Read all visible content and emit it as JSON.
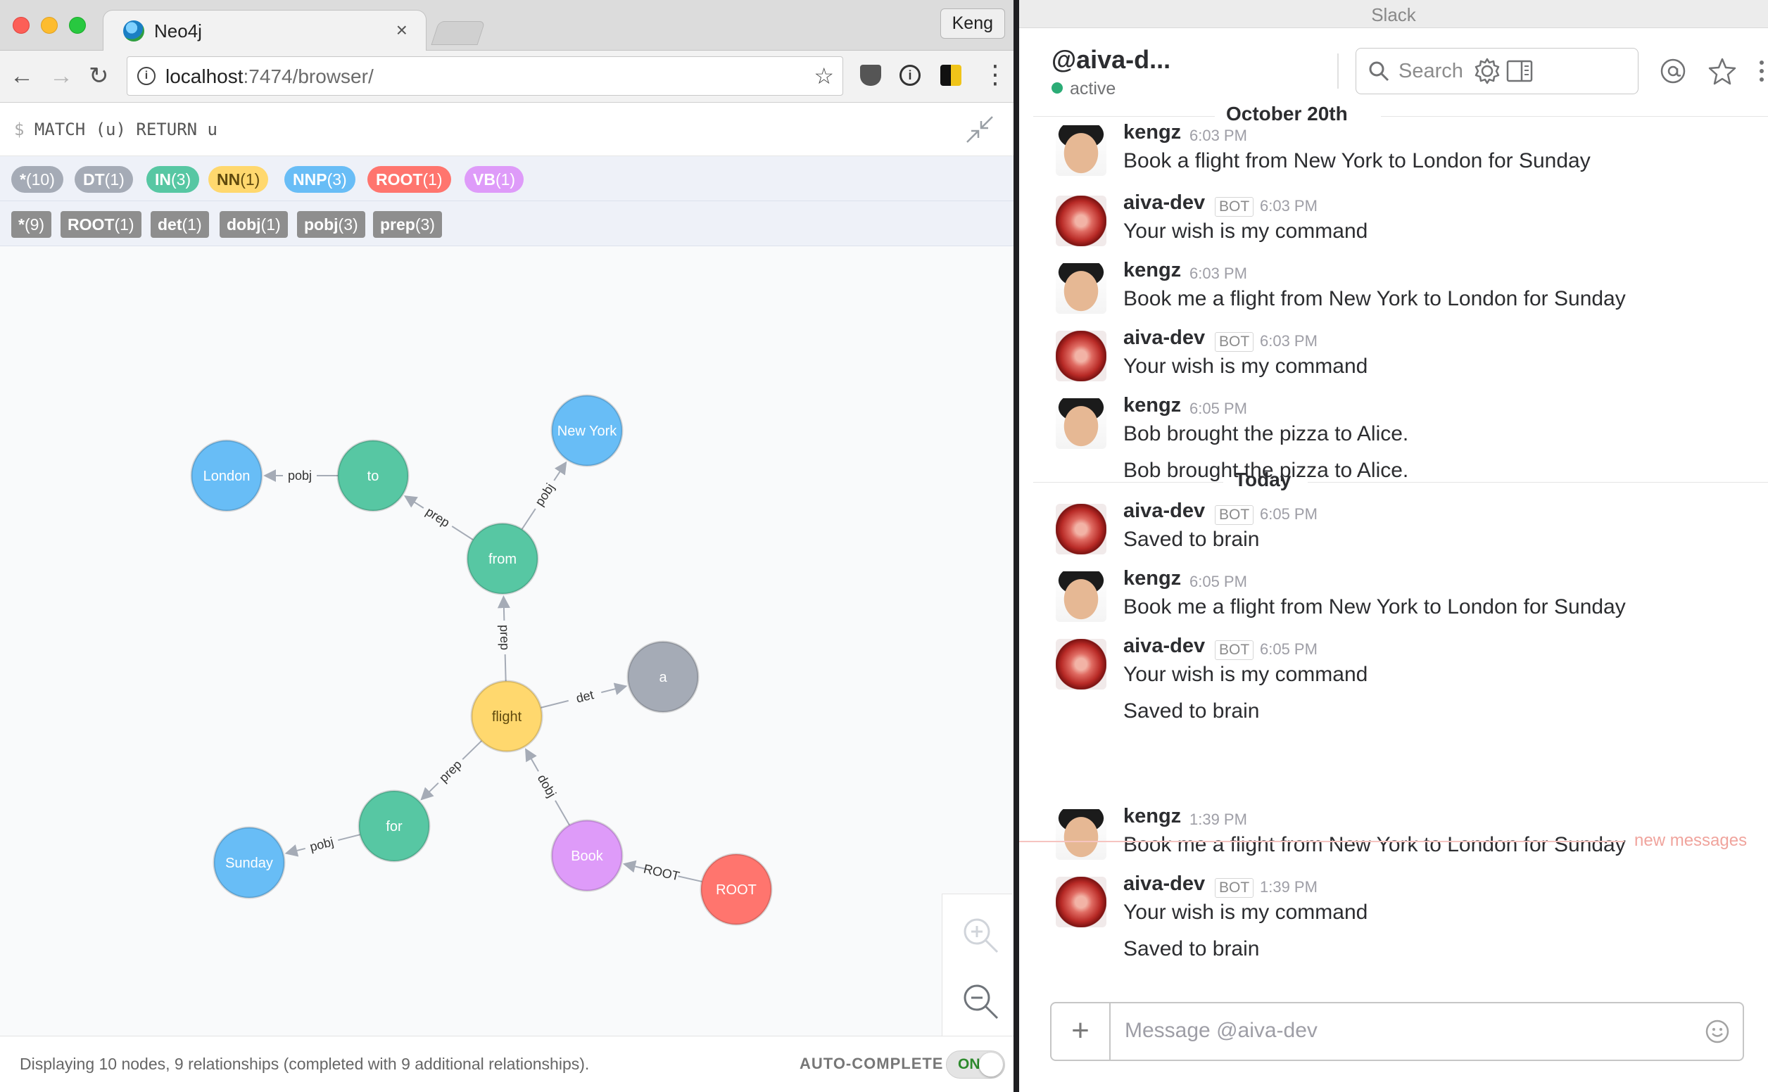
{
  "browser": {
    "tab_title": "Neo4j",
    "tab_close": "×",
    "profile_name": "Keng",
    "url_host": "localhost",
    "url_path": ":7474/browser/",
    "nav_back": "←",
    "nav_forward": "→",
    "nav_reload": "↻",
    "menu_dots": "⋮",
    "star": "☆",
    "info": "i"
  },
  "neo4j": {
    "query_prompt": "$",
    "query": "MATCH (u) RETURN u",
    "node_labels": [
      {
        "name": "*",
        "count": "(10)",
        "color": "#a5abb6",
        "text_color": "#ffffff"
      },
      {
        "name": "DT",
        "count": "(1)",
        "color": "#a5abb6",
        "text_color": "#ffffff"
      },
      {
        "name": "IN",
        "count": "(3)",
        "color": "#57c7a3",
        "text_color": "#ffffff"
      },
      {
        "name": "NN",
        "count": "(1)",
        "color": "#ffd86e",
        "text_color": "#604a0e"
      },
      {
        "name": "NNP",
        "count": "(3)",
        "color": "#68bdf6",
        "text_color": "#ffffff"
      },
      {
        "name": "ROOT",
        "count": "(1)",
        "color": "#ff756e",
        "text_color": "#ffffff"
      },
      {
        "name": "VB",
        "count": "(1)",
        "color": "#de9bf9",
        "text_color": "#ffffff"
      }
    ],
    "relationship_types": [
      {
        "name": "*",
        "count": "(9)"
      },
      {
        "name": "ROOT",
        "count": "(1)"
      },
      {
        "name": "det",
        "count": "(1)"
      },
      {
        "name": "dobj",
        "count": "(1)"
      },
      {
        "name": "pobj",
        "count": "(3)"
      },
      {
        "name": "prep",
        "count": "(3)"
      }
    ],
    "graph": {
      "nodes": [
        {
          "id": "london",
          "label": "London",
          "type": "NNP"
        },
        {
          "id": "to",
          "label": "to",
          "type": "IN"
        },
        {
          "id": "newyork",
          "label": "New York",
          "type": "NNP"
        },
        {
          "id": "from",
          "label": "from",
          "type": "IN"
        },
        {
          "id": "a",
          "label": "a",
          "type": "DT"
        },
        {
          "id": "flight",
          "label": "flight",
          "type": "NN"
        },
        {
          "id": "for",
          "label": "for",
          "type": "IN"
        },
        {
          "id": "sunday",
          "label": "Sunday",
          "type": "NNP"
        },
        {
          "id": "book",
          "label": "Book",
          "type": "VB"
        },
        {
          "id": "root",
          "label": "ROOT",
          "type": "ROOT"
        }
      ],
      "edges": [
        {
          "from": "to",
          "to": "london",
          "label": "pobj"
        },
        {
          "from": "from",
          "to": "to",
          "label": "prep"
        },
        {
          "from": "from",
          "to": "newyork",
          "label": "pobj"
        },
        {
          "from": "flight",
          "to": "from",
          "label": "prep"
        },
        {
          "from": "flight",
          "to": "a",
          "label": "det"
        },
        {
          "from": "flight",
          "to": "for",
          "label": "prep"
        },
        {
          "from": "for",
          "to": "sunday",
          "label": "pobj"
        },
        {
          "from": "book",
          "to": "flight",
          "label": "dobj"
        },
        {
          "from": "root",
          "to": "book",
          "label": "ROOT"
        }
      ]
    },
    "status": "Displaying 10 nodes, 9 relationships (completed with 9 additional relationships).",
    "autocomplete_label": "AUTO-COMPLETE",
    "autocomplete_state": "ON"
  },
  "slack": {
    "window_title": "Slack",
    "channel": "@aiva-d...",
    "presence": "active",
    "search_placeholder": "Search",
    "day_dividers": [
      "October 20th",
      "Today"
    ],
    "messages": [
      {
        "author": "kengz",
        "bot": false,
        "time": "6:03 PM",
        "lines": [
          "Book a flight from New York to London for Sunday"
        ]
      },
      {
        "author": "aiva-dev",
        "bot": true,
        "time": "6:03 PM",
        "lines": [
          "Your wish is my command"
        ]
      },
      {
        "author": "kengz",
        "bot": false,
        "time": "6:03 PM",
        "lines": [
          "Book me a flight from New York to London for Sunday"
        ]
      },
      {
        "author": "aiva-dev",
        "bot": true,
        "time": "6:03 PM",
        "lines": [
          "Your wish is my command"
        ]
      },
      {
        "author": "kengz",
        "bot": false,
        "time": "6:05 PM",
        "lines": [
          "Bob brought the pizza to Alice.",
          "Bob brought the pizza to Alice."
        ]
      },
      {
        "author": "aiva-dev",
        "bot": true,
        "time": "6:05 PM",
        "lines": [
          "Saved to brain"
        ]
      },
      {
        "author": "kengz",
        "bot": false,
        "time": "6:05 PM",
        "lines": [
          "Book me a flight from New York to London for Sunday"
        ]
      },
      {
        "author": "aiva-dev",
        "bot": true,
        "time": "6:05 PM",
        "lines": [
          "Your wish is my command",
          "Saved to brain"
        ]
      },
      {
        "author": "kengz",
        "bot": false,
        "time": "1:39 PM",
        "lines": [
          "Book me a flight from New York to London for Sunday"
        ]
      },
      {
        "author": "aiva-dev",
        "bot": true,
        "time": "1:39 PM",
        "lines": [
          "Your wish is my command",
          "Saved to brain"
        ]
      }
    ],
    "bot_badge": "BOT",
    "new_messages": "new messages",
    "composer_plus": "+",
    "composer_placeholder": "Message @aiva-dev"
  }
}
